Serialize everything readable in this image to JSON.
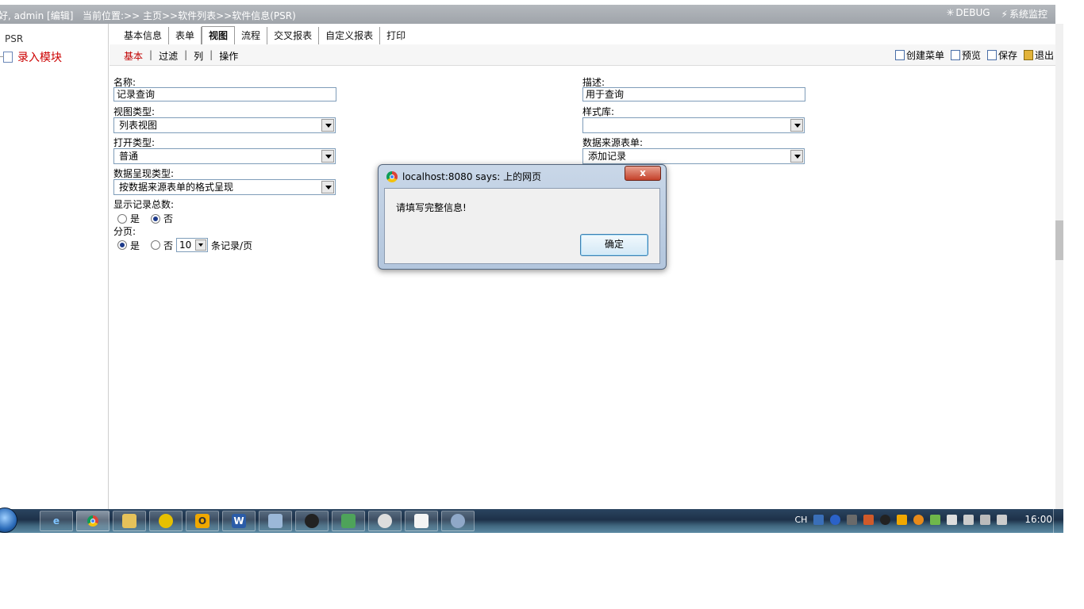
{
  "header": {
    "greeting": "好, admin [编辑]",
    "breadcrumb_label": "当前位置:",
    "breadcrumb": ">> 主页>>软件列表>>软件信息(PSR)",
    "debug_label": "DEBUG",
    "monitor_label": "系统监控"
  },
  "tree": {
    "root": "PSR",
    "node": "录入模块"
  },
  "tabs": [
    "基本信息",
    "表单",
    "视图",
    "流程",
    "交叉报表",
    "自定义报表",
    "打印"
  ],
  "active_tab": "视图",
  "subtabs": [
    "基本",
    "过滤",
    "列",
    "操作"
  ],
  "subtab_sep": "|",
  "actions": {
    "create_menu": "创建菜单",
    "preview": "预览",
    "save": "保存",
    "exit": "退出"
  },
  "form": {
    "name_label": "名称:",
    "name_value": "记录查询",
    "desc_label": "描述:",
    "desc_value": "用于查询",
    "view_type_label": "视图类型:",
    "view_type_value": "列表视图",
    "style_lib_label": "样式库:",
    "style_lib_value": "",
    "open_type_label": "打开类型:",
    "open_type_value": "普通",
    "source_form_label": "数据来源表单:",
    "source_form_value": "添加记录",
    "display_type_label": "数据呈现类型:",
    "display_type_value": "按数据来源表单的格式呈现",
    "show_total_label": "显示记录总数:",
    "yes": "是",
    "no": "否",
    "paging_label": "分页:",
    "page_size": "10",
    "page_size_suffix": "条记录/页"
  },
  "dialog": {
    "title": "localhost:8080 says: 上的网页",
    "close": "x",
    "message": "请填写完整信息!",
    "ok": "确定"
  },
  "tray": {
    "lang": "CH",
    "time": "16:00"
  }
}
